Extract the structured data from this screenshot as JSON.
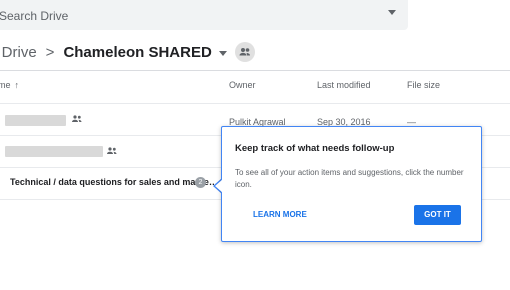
{
  "search": {
    "placeholder": "Search Drive"
  },
  "breadcrumb": {
    "root": "y Drive",
    "separator": ">",
    "current": "Chameleon SHARED"
  },
  "columns": {
    "name": "me",
    "owner": "Owner",
    "last_modified": "Last modified",
    "file_size": "File size"
  },
  "rows": [
    {
      "owner": "Pulkit Agrawal",
      "modified": "Sep 30, 2016",
      "size": "—"
    },
    {
      "owner": "",
      "modified": "",
      "size": ""
    },
    {
      "name": "Technical / data questions for sales and marke…",
      "badge": "2"
    }
  ],
  "tooltip": {
    "title": "Keep track of what needs follow-up",
    "body": "To see all of your action items and suggestions, click the number icon.",
    "learn_more": "LEARN MORE",
    "got_it": "GOT IT"
  },
  "icons": {
    "search_dropdown": "caret-down-icon",
    "shared_folder": "people-icon",
    "sort": "arrow-up-icon"
  },
  "colors": {
    "accent": "#1a73e8",
    "tooltip_border": "#4285f4",
    "search_bg": "#f1f3f4",
    "badge": "#9aa0a6"
  }
}
